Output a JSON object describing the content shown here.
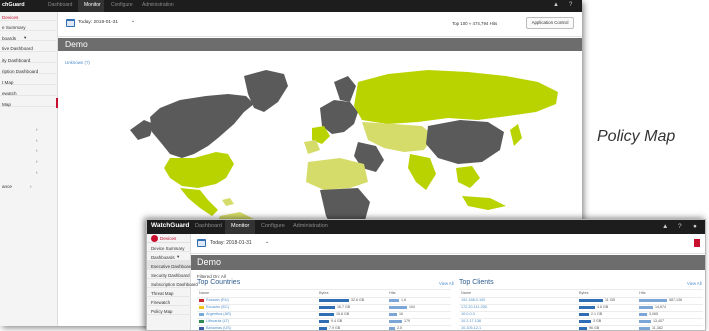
{
  "caption": "Policy Map",
  "colors": {
    "topbar": "#1d1d1d",
    "title_bar": "#6d6d6d",
    "accent_red": "#c8102e",
    "link_blue": "#4a8cc9",
    "land_dark": "#5a5a5a",
    "land_highlight": "#b9d300",
    "land_light": "#d6dc6a"
  },
  "back_window": {
    "brand": "chGuard",
    "nav": [
      "Dashboard",
      "Monitor",
      "Configure",
      "Administration"
    ],
    "active_nav": "Monitor",
    "sidebar": [
      "Devices",
      "e Summary",
      "boards",
      "tive Dashboard",
      "ity Dashboard",
      "ription Dashboard",
      "t Map",
      "ewatch",
      "Map",
      "ance"
    ],
    "toolbar": {
      "date": "Today: 2018-01-31",
      "top_select": "Top 100 » 474,794 Hits",
      "app_control": "Application Control"
    },
    "title": "Demo",
    "unknown_link": "Unknown (?)"
  },
  "front_window": {
    "brand": "WatchGuard",
    "nav": [
      "Dashboard",
      "Monitor",
      "Configure",
      "Administration"
    ],
    "active_nav": "Monitor",
    "sidebar": {
      "home": "Devices",
      "items": [
        "Device Summary",
        "Dashboards",
        "Executive Dashboard",
        "Security Dashboard",
        "Subscription Dashboard",
        "Threat Map",
        "Firewatch",
        "Policy Map"
      ],
      "selected": "Executive Dashboard"
    },
    "toolbar": {
      "date": "Today: 2018-01-31"
    },
    "title": "Demo",
    "filter": "Filtered On: All",
    "top_countries": {
      "title": "Top Countries",
      "view_all": "View All",
      "headers": [
        "Name",
        "Bytes",
        "Hits"
      ],
      "rows": [
        {
          "name": "Russian (RU)",
          "bytes": "32.6 GB",
          "hits": "1,6"
        },
        {
          "name": "Ecuador (EC)",
          "bytes": "16.7 GB",
          "hits": "104"
        },
        {
          "name": "Argentina (AR)",
          "bytes": "15.8 GB",
          "hits": "16"
        },
        {
          "name": "Lithuania (LT)",
          "bytes": "9.4 GB",
          "hits": "179"
        },
        {
          "name": "Bahamas (US)",
          "bytes": "7.9 GB",
          "hits": "2.5"
        }
      ]
    },
    "top_clients": {
      "title": "Top Clients",
      "view_all": "View All",
      "headers": [
        "Name",
        "Bytes",
        "Hits"
      ],
      "rows": [
        {
          "name": "192.168.0.100",
          "bytes": "11 GB",
          "hits": "587,136"
        },
        {
          "name": "172.20.111.250",
          "bytes": "4.6 GB",
          "hits": "14,674"
        },
        {
          "name": "10.0.0.3",
          "bytes": "2.1 GB",
          "hits": "3,065"
        },
        {
          "name": "10.2.17.136",
          "bytes": "3 GB",
          "hits": "13,407"
        },
        {
          "name": "10.105.12.1",
          "bytes": "96 GB",
          "hits": "11,382"
        }
      ]
    }
  }
}
